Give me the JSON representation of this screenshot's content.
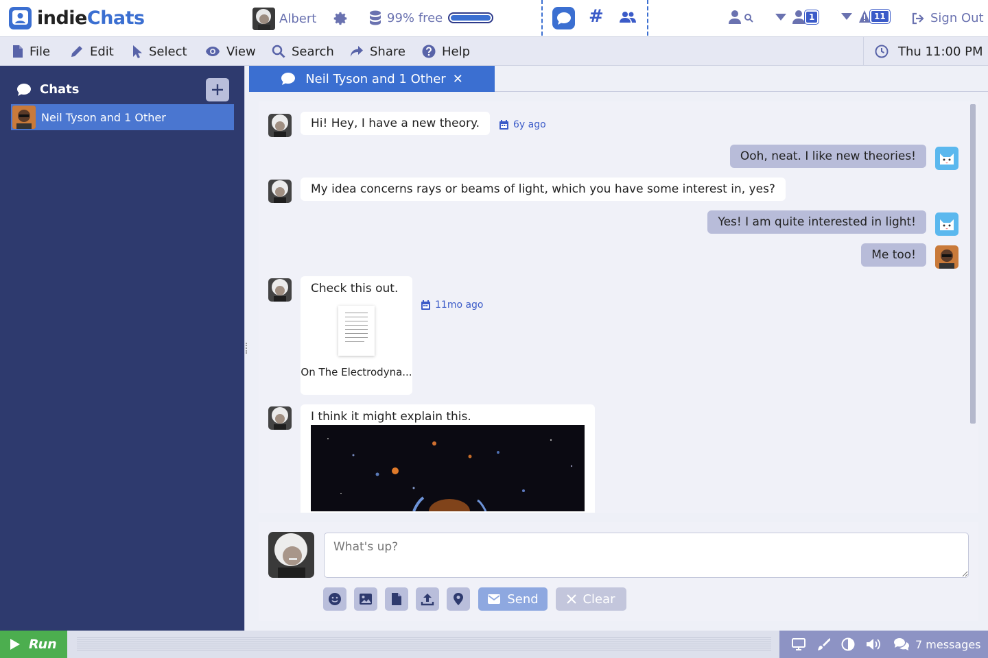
{
  "app": {
    "logo_part1": "indie",
    "logo_part2": "Chats",
    "brand_color": "#3b6fd1"
  },
  "header": {
    "user_name": "Albert",
    "storage_text": "99% free",
    "storage_fraction": 0.99,
    "contacts_badge": "1",
    "alerts_badge": "11",
    "sign_out": "Sign Out"
  },
  "menu": {
    "items": [
      {
        "label": "File",
        "icon": "file-icon"
      },
      {
        "label": "Edit",
        "icon": "pencil-icon"
      },
      {
        "label": "Select",
        "icon": "pointer-icon"
      },
      {
        "label": "View",
        "icon": "eye-icon"
      },
      {
        "label": "Search",
        "icon": "search-icon"
      },
      {
        "label": "Share",
        "icon": "share-icon"
      },
      {
        "label": "Help",
        "icon": "help-icon"
      }
    ],
    "clock": "Thu 11:00 PM"
  },
  "sidebar": {
    "title": "Chats",
    "chats": [
      {
        "label": "Neil Tyson and 1 Other",
        "selected": true
      }
    ]
  },
  "tab": {
    "label": "Neil Tyson and 1 Other"
  },
  "messages": [
    {
      "sender": "Albert",
      "side": "left",
      "text": "Hi!   Hey, I have a new theory.",
      "stamp": "6y ago"
    },
    {
      "sender": "cat",
      "side": "right",
      "text": "Ooh, neat.   I like new theories!"
    },
    {
      "sender": "Albert",
      "side": "left",
      "text": "My idea concerns rays or beams of light, which you have some interest in, yes?"
    },
    {
      "sender": "cat",
      "side": "right",
      "text": "Yes!  I am quite interested in light!"
    },
    {
      "sender": "Neil Tyson",
      "side": "right",
      "text": "Me too!"
    },
    {
      "sender": "Albert",
      "side": "left",
      "text": "Check this out.",
      "stamp": "11mo ago",
      "attachment": "On The Electrodyna..."
    },
    {
      "sender": "Albert",
      "side": "left",
      "text": "I think it might explain this.",
      "image": "space-photo"
    }
  ],
  "composer": {
    "placeholder": "What's up?",
    "send_label": "Send",
    "clear_label": "Clear"
  },
  "status": {
    "run_label": "Run",
    "message_count": "7 messages"
  }
}
